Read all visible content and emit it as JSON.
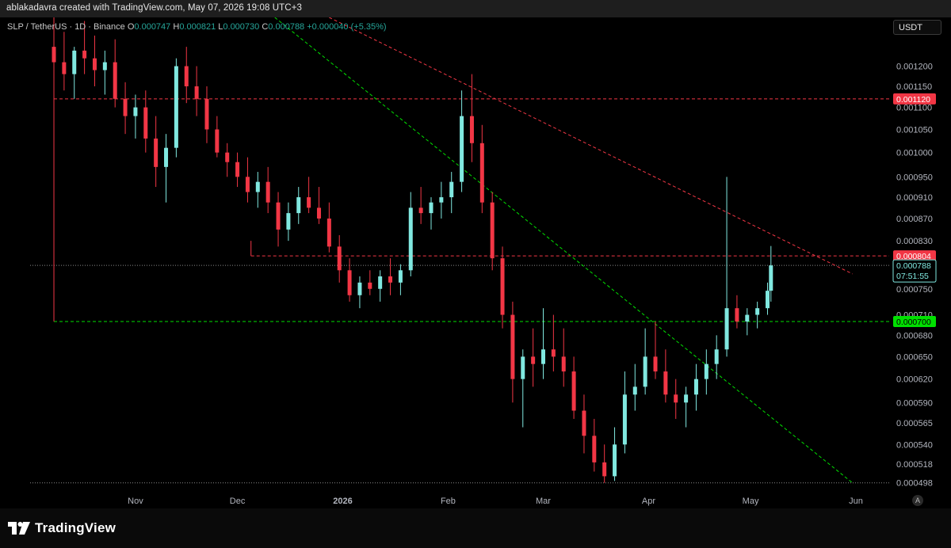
{
  "header": {
    "text": "ablakadavra created with TradingView.com, May 07, 2026 19:08 UTC+3"
  },
  "legend": {
    "symbol": "SLP / TetherUS · 1D · Binance",
    "o_label": "O",
    "o_value": "0.000747",
    "h_label": "H",
    "h_value": "0.000821",
    "l_label": "L",
    "l_value": "0.000730",
    "c_label": "C",
    "c_value": "0.000788",
    "change": "+0.000040 (+5.35%)"
  },
  "currency_button": "USDT",
  "auto_button": "A",
  "footer": {
    "logo_text": "TradingView"
  },
  "colors": {
    "up": "#80e8e0",
    "down": "#f23645",
    "grid_text": "#b2b5be",
    "red_level": "#f23645",
    "green_level": "#00e000",
    "background": "#000000"
  },
  "chart_data": {
    "type": "candlestick",
    "title": "SLP / TetherUS · 1D · Binance",
    "y_scale": "log",
    "ylim": [
      0.000492,
      0.00133
    ],
    "y_ticks": [
      "0.001200",
      "0.001150",
      "0.001100",
      "0.001050",
      "0.001000",
      "0.000950",
      "0.000910",
      "0.000870",
      "0.000830",
      "0.000750",
      "0.000710",
      "0.000680",
      "0.000650",
      "0.000620",
      "0.000590",
      "0.000565",
      "0.000540",
      "0.000518",
      "0.000498"
    ],
    "x_ticks": [
      {
        "label": "Nov",
        "date": "2025-11-01",
        "bold": false
      },
      {
        "label": "Dec",
        "date": "2025-12-01",
        "bold": false
      },
      {
        "label": "2026",
        "date": "2026-01-01",
        "bold": true
      },
      {
        "label": "Feb",
        "date": "2026-02-01",
        "bold": false
      },
      {
        "label": "Mar",
        "date": "2026-03-01",
        "bold": false
      },
      {
        "label": "Apr",
        "date": "2026-04-01",
        "bold": false
      },
      {
        "label": "May",
        "date": "2026-05-01",
        "bold": false
      },
      {
        "label": "Jun",
        "date": "2026-06-01",
        "bold": false
      }
    ],
    "price_labels": [
      {
        "value": 0.00112,
        "text": "0.001120",
        "style": "red"
      },
      {
        "value": 0.000804,
        "text": "0.000804",
        "style": "red"
      },
      {
        "value": 0.000788,
        "text": "0.000788",
        "subtext": "07:51:55",
        "style": "current"
      },
      {
        "value": 0.0007,
        "text": "0.000700",
        "style": "green"
      }
    ],
    "horizontal_levels": [
      {
        "value": 0.00112,
        "from": "2025-10-08",
        "color": "red",
        "style": "dashed"
      },
      {
        "value": 0.000804,
        "from": "2025-12-05",
        "color": "red",
        "style": "dashed"
      },
      {
        "value": 0.0007,
        "from": "2025-10-08",
        "color": "green",
        "style": "dashed"
      },
      {
        "value": 0.000788,
        "from": "2025-10-01",
        "color": "gray",
        "style": "dotted"
      },
      {
        "value": 0.000498,
        "from": "2025-10-01",
        "color": "gray",
        "style": "dotted"
      }
    ],
    "trendlines": [
      {
        "color": "red",
        "style": "dashed",
        "from": {
          "date": "2025-12-28",
          "value": 0.00133
        },
        "to": {
          "date": "2026-05-31",
          "value": 0.000774
        }
      },
      {
        "color": "green",
        "style": "dashed",
        "from": {
          "date": "2025-12-12",
          "value": 0.00133
        },
        "to": {
          "date": "2026-05-31",
          "value": 0.000498
        }
      }
    ],
    "candles": [
      [
        "2025-10-08",
        0.00125,
        0.00133,
        0.00117,
        0.00121
      ],
      [
        "2025-10-11",
        0.00121,
        0.00129,
        0.00114,
        0.00118
      ],
      [
        "2025-10-14",
        0.00118,
        0.00125,
        0.00112,
        0.00124
      ],
      [
        "2025-10-17",
        0.00124,
        0.00132,
        0.00118,
        0.00122
      ],
      [
        "2025-10-20",
        0.00122,
        0.00128,
        0.00115,
        0.00119
      ],
      [
        "2025-10-23",
        0.00119,
        0.00124,
        0.00113,
        0.00121
      ],
      [
        "2025-10-26",
        0.00121,
        0.00127,
        0.0011,
        0.00112
      ],
      [
        "2025-10-29",
        0.00112,
        0.00116,
        0.00104,
        0.00108
      ],
      [
        "2025-11-01",
        0.00108,
        0.00113,
        0.00103,
        0.0011
      ],
      [
        "2025-11-04",
        0.0011,
        0.00114,
        0.001,
        0.00103
      ],
      [
        "2025-11-07",
        0.00103,
        0.00108,
        0.00093,
        0.00097
      ],
      [
        "2025-11-10",
        0.00097,
        0.00104,
        0.0009,
        0.00101
      ],
      [
        "2025-11-13",
        0.00101,
        0.00122,
        0.00099,
        0.0012
      ],
      [
        "2025-11-16",
        0.0012,
        0.00125,
        0.00111,
        0.00115
      ],
      [
        "2025-11-19",
        0.00115,
        0.0012,
        0.00108,
        0.00112
      ],
      [
        "2025-11-22",
        0.00112,
        0.00115,
        0.00102,
        0.00105
      ],
      [
        "2025-11-25",
        0.00105,
        0.00108,
        0.00099,
        0.001
      ],
      [
        "2025-11-28",
        0.001,
        0.00102,
        0.00095,
        0.00098
      ],
      [
        "2025-12-01",
        0.00098,
        0.001,
        0.00093,
        0.00095
      ],
      [
        "2025-12-04",
        0.00095,
        0.00099,
        0.0009,
        0.00092
      ],
      [
        "2025-12-07",
        0.00092,
        0.00096,
        0.00089,
        0.00094
      ],
      [
        "2025-12-10",
        0.00094,
        0.00097,
        0.00088,
        0.0009
      ],
      [
        "2025-12-13",
        0.0009,
        0.00092,
        0.00082,
        0.00085
      ],
      [
        "2025-12-16",
        0.00085,
        0.0009,
        0.00083,
        0.00088
      ],
      [
        "2025-12-19",
        0.00088,
        0.00093,
        0.00086,
        0.00091
      ],
      [
        "2025-12-22",
        0.00091,
        0.00095,
        0.00088,
        0.00089
      ],
      [
        "2025-12-25",
        0.00089,
        0.00093,
        0.00086,
        0.00087
      ],
      [
        "2025-12-28",
        0.00087,
        0.0009,
        0.00081,
        0.00082
      ],
      [
        "2025-12-31",
        0.00082,
        0.00084,
        0.00076,
        0.00078
      ],
      [
        "2026-01-03",
        0.00078,
        0.0008,
        0.00073,
        0.00074
      ],
      [
        "2026-01-06",
        0.00074,
        0.00077,
        0.00072,
        0.00076
      ],
      [
        "2026-01-09",
        0.00076,
        0.00078,
        0.00074,
        0.00075
      ],
      [
        "2026-01-12",
        0.00075,
        0.00078,
        0.00073,
        0.00077
      ],
      [
        "2026-01-15",
        0.00077,
        0.0008,
        0.00074,
        0.00076
      ],
      [
        "2026-01-18",
        0.00076,
        0.00079,
        0.00074,
        0.00078
      ],
      [
        "2026-01-21",
        0.00078,
        0.00092,
        0.00077,
        0.00089
      ],
      [
        "2026-01-24",
        0.00089,
        0.00093,
        0.00086,
        0.00088
      ],
      [
        "2026-01-27",
        0.00088,
        0.00091,
        0.00085,
        0.0009
      ],
      [
        "2026-01-30",
        0.0009,
        0.00094,
        0.00087,
        0.00091
      ],
      [
        "2026-02-02",
        0.00091,
        0.00096,
        0.00088,
        0.00094
      ],
      [
        "2026-02-05",
        0.00094,
        0.00114,
        0.00092,
        0.00108
      ],
      [
        "2026-02-08",
        0.00108,
        0.00118,
        0.00098,
        0.00102
      ],
      [
        "2026-02-11",
        0.00102,
        0.00106,
        0.00088,
        0.0009
      ],
      [
        "2026-02-14",
        0.0009,
        0.00092,
        0.00078,
        0.0008
      ],
      [
        "2026-02-17",
        0.0008,
        0.00082,
        0.00069,
        0.00071
      ],
      [
        "2026-02-20",
        0.00071,
        0.00073,
        0.00059,
        0.00062
      ],
      [
        "2026-02-23",
        0.00062,
        0.00066,
        0.00056,
        0.00065
      ],
      [
        "2026-02-26",
        0.00065,
        0.00069,
        0.00061,
        0.00064
      ],
      [
        "2026-03-01",
        0.00064,
        0.00072,
        0.00062,
        0.00066
      ],
      [
        "2026-03-04",
        0.00066,
        0.00071,
        0.00063,
        0.00065
      ],
      [
        "2026-03-07",
        0.00065,
        0.00069,
        0.00061,
        0.00063
      ],
      [
        "2026-03-10",
        0.00063,
        0.00065,
        0.00057,
        0.00058
      ],
      [
        "2026-03-13",
        0.00058,
        0.0006,
        0.00053,
        0.00055
      ],
      [
        "2026-03-16",
        0.00055,
        0.00057,
        0.00051,
        0.00052
      ],
      [
        "2026-03-19",
        0.00052,
        0.00054,
        0.000498,
        0.000505
      ],
      [
        "2026-03-22",
        0.000505,
        0.00056,
        0.0005,
        0.00054
      ],
      [
        "2026-03-25",
        0.00054,
        0.00063,
        0.00053,
        0.0006
      ],
      [
        "2026-03-28",
        0.0006,
        0.00064,
        0.00058,
        0.00061
      ],
      [
        "2026-03-31",
        0.00061,
        0.00069,
        0.0006,
        0.00065
      ],
      [
        "2026-04-03",
        0.00065,
        0.0007,
        0.00062,
        0.00063
      ],
      [
        "2026-04-06",
        0.00063,
        0.00066,
        0.00059,
        0.0006
      ],
      [
        "2026-04-09",
        0.0006,
        0.00062,
        0.00057,
        0.00059
      ],
      [
        "2026-04-12",
        0.00059,
        0.00061,
        0.00056,
        0.0006
      ],
      [
        "2026-04-15",
        0.0006,
        0.00064,
        0.00058,
        0.00062
      ],
      [
        "2026-04-18",
        0.00062,
        0.00066,
        0.0006,
        0.00064
      ],
      [
        "2026-04-21",
        0.00064,
        0.00068,
        0.00062,
        0.00066
      ],
      [
        "2026-04-24",
        0.00066,
        0.00095,
        0.00065,
        0.00072
      ],
      [
        "2026-04-27",
        0.00072,
        0.00074,
        0.00069,
        0.0007
      ],
      [
        "2026-04-30",
        0.0007,
        0.00072,
        0.00068,
        0.00071
      ],
      [
        "2026-05-03",
        0.00071,
        0.00073,
        0.00069,
        0.00072
      ],
      [
        "2026-05-06",
        0.00072,
        0.00076,
        0.00071,
        0.000747
      ],
      [
        "2026-05-07",
        0.000747,
        0.000821,
        0.00073,
        0.000788
      ]
    ]
  }
}
